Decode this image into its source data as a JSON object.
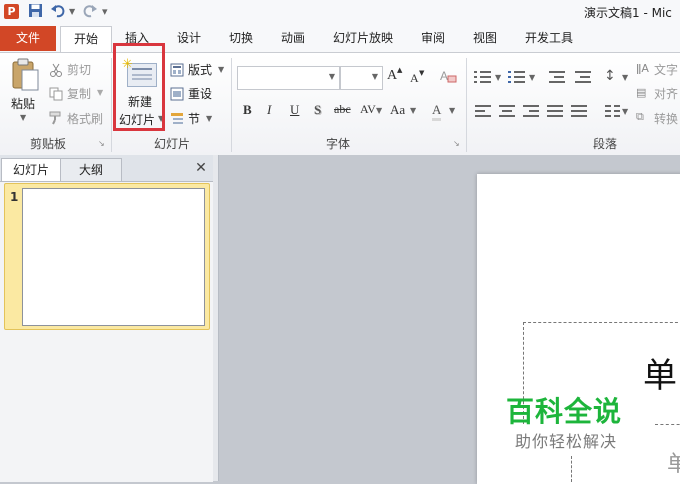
{
  "window": {
    "app_icon_letter": "P",
    "title": "演示文稿1 - Mic"
  },
  "quick_access": {
    "save_icon": "save-icon",
    "undo_icon": "undo-icon",
    "redo_icon": "redo-icon",
    "customize_icon": "customize-icon"
  },
  "tabs": {
    "file": "文件",
    "home": "开始",
    "insert": "插入",
    "design": "设计",
    "transitions": "切换",
    "animations": "动画",
    "slideshow": "幻灯片放映",
    "review": "审阅",
    "view": "视图",
    "developer": "开发工具"
  },
  "ribbon": {
    "clipboard": {
      "label": "剪贴板",
      "paste": "粘贴",
      "cut": "剪切",
      "copy": "复制",
      "format_painter": "格式刷"
    },
    "slides": {
      "label": "幻灯片",
      "new_slide_line1": "新建",
      "new_slide_line2": "幻灯片",
      "layout": "版式",
      "reset": "重设",
      "section": "节"
    },
    "font": {
      "label": "字体",
      "font_name": "",
      "font_size": "",
      "bold": "B",
      "italic": "I",
      "underline": "U",
      "shadow": "S",
      "strike": "abc",
      "spacing": "AV",
      "case": "Aa",
      "color": "A",
      "grow": "A",
      "shrink": "A"
    },
    "paragraph": {
      "label": "段落",
      "text_direction": "文字",
      "align_text": "对齐",
      "convert": "转换"
    }
  },
  "left_pane": {
    "tab_slides": "幻灯片",
    "tab_outline": "大纲",
    "close": "✕",
    "slide_number": "1"
  },
  "slide": {
    "title_fragment": "单",
    "subtitle_fragment": "单"
  },
  "watermark": {
    "main": "百科全说",
    "sub": "助你轻松解决"
  },
  "colors": {
    "accent": "#d24726",
    "highlight": "#d9363e",
    "watermark": "#1db53b"
  }
}
